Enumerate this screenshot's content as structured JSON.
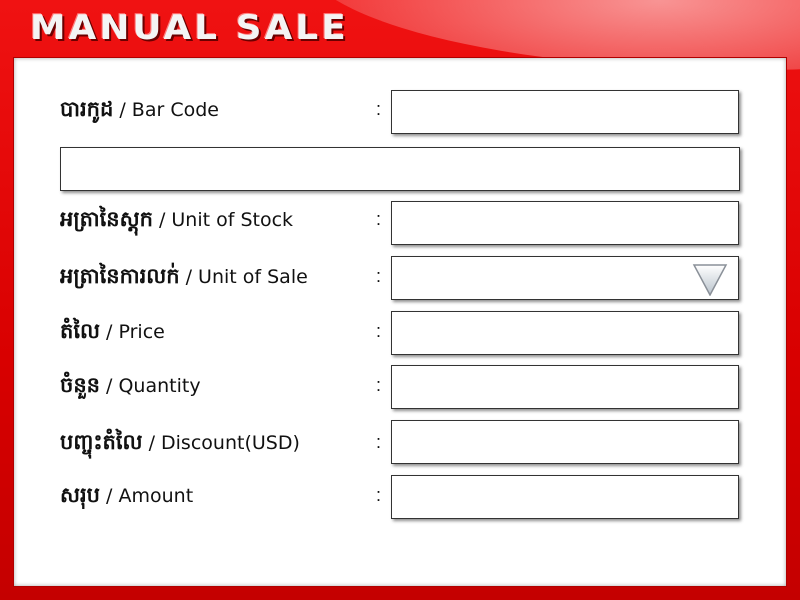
{
  "window": {
    "title": "MANUAL SALE"
  },
  "form": {
    "fields": [
      {
        "label_km": "បារកូដ",
        "label_en": " / Bar Code",
        "value": ""
      },
      {
        "label_km": "អត្រានៃស្តុក",
        "label_en": " / Unit of Stock",
        "value": ""
      },
      {
        "label_km": "អត្រានៃការលក់",
        "label_en": " / Unit of Sale",
        "value": ""
      },
      {
        "label_km": "តំលៃ",
        "label_en": " / Price",
        "value": ""
      },
      {
        "label_km": "ចំនួន",
        "label_en": " / Quantity",
        "value": ""
      },
      {
        "label_km": "បញ្ចុះតំលៃ",
        "label_en": " / Discount(USD)",
        "value": ""
      },
      {
        "label_km": "សរុប",
        "label_en": " / Amount",
        "value": ""
      }
    ],
    "colon": ":",
    "barcode_description": ""
  },
  "icons": {
    "dropdown": "triangle-down-icon"
  },
  "colors": {
    "frame": "#d80000",
    "panel": "#ffffff"
  }
}
